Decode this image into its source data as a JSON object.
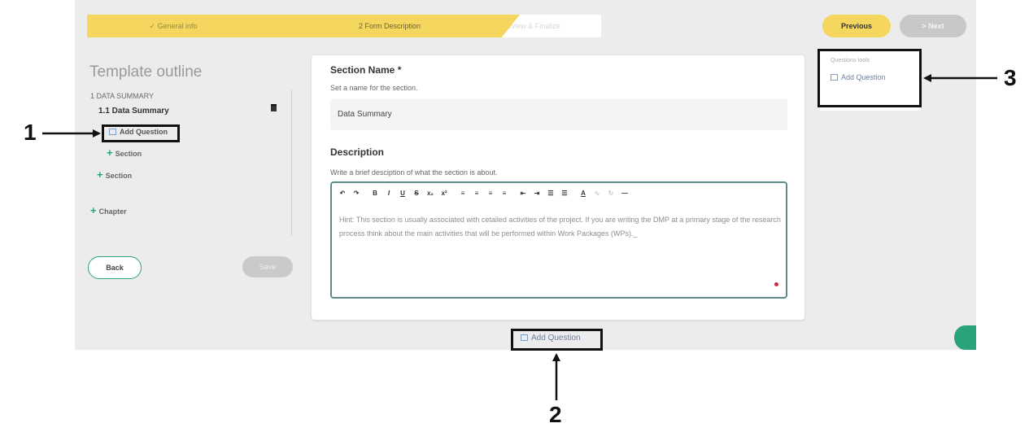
{
  "stepper": {
    "step1": "✓ General info",
    "step2": "2 Form Description",
    "step3": "3 Preview & Finalize"
  },
  "nav": {
    "previous": "Previous",
    "next": "> Next"
  },
  "outline": {
    "title": "Template outline",
    "chapter_label": "1 DATA SUMMARY",
    "section_label": "1.1 Data Summary",
    "add_question": "Add Question",
    "add_section_inner": "Section",
    "add_section_outer": "Section",
    "add_chapter": "Chapter",
    "back": "Back",
    "save": "Save"
  },
  "form": {
    "section_name_label": "Section Name *",
    "section_name_help": "Set a name for the section.",
    "section_name_value": "Data Summary",
    "description_label": "Description",
    "description_help": "Write a brief desciption of what the section is about.",
    "hint_text": "Hint: This section is usually associated with cetailed activities of the project. If you are writing the DMP at a primary stage of the research process think about the main activities that will be performed within Work Packages (WPs)._"
  },
  "toolbar": [
    "↶",
    "↷",
    "B",
    "I",
    "U",
    "S",
    "x₂",
    "x²",
    "≡",
    "≡",
    "≡",
    "≡",
    "⇤",
    "⇥",
    "☰",
    "☰",
    "A",
    "∿",
    "↻",
    "—"
  ],
  "questions_tools": {
    "title": "Questions tools",
    "add": "Add Question"
  },
  "bottom": {
    "add_question": "Add Question"
  },
  "annotations": {
    "one": "1",
    "two": "2",
    "three": "3"
  },
  "colors": {
    "accent_yellow": "#f5d65e",
    "accent_green": "#2aa37b",
    "editor_border": "#5f8a8a"
  }
}
